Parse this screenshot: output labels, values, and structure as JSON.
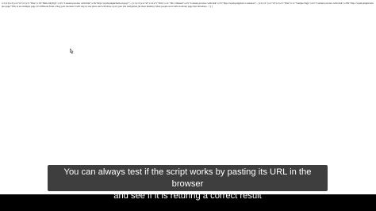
{
  "browser_page": {
    "raw_output_line1": "a:3:{i:0;a:3:{s:2:\"id\";i:5;s:5:\"Title\";s:10:\"Hello MySQL\";s:25:\"Content preview with link\";s:36:\"http://wpsh.plugin/hello-mysql/\";...}i:1;a:3:{s:2:\"id\";i:14;s:5:\"Title\";s:11:\"ID-1 Manual\";s:25:\"Content preview with link\";s:33:\"http://wpsh.plugin/id-1-manual/\";...}i:2;a:3:",
    "raw_output_line2": "{s:2:\"id\";i:2;s:5:\"Title\";s:11:\"Sample Page\";s:25:\"Content preview with link\";s:230:\"http://wpsh.plugin/sample-page/\"This is an example page. It's different from a blog post because it will stay in one place and will show up in your site navigation (in most themes). Most people start with an About",
    "raw_output_line3": "page that introduce...\";}}"
  },
  "subtitle": {
    "line1": "You can always test if the script works by pasting its URL in the browser",
    "line2": "and see if it is returing a correct result"
  },
  "colors": {
    "page_background": "#ffffff",
    "letterbox": "#000000",
    "caption_background": "#141414",
    "caption_text": "#ffffff"
  },
  "icons": {
    "cursor": "mouse-pointer-icon"
  }
}
